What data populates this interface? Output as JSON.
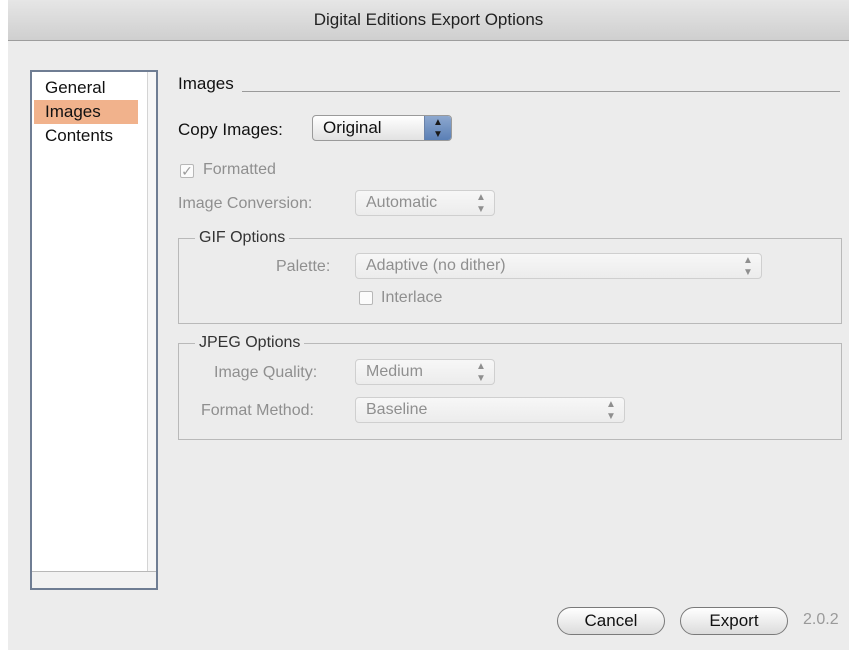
{
  "window": {
    "title": "Digital Editions Export Options"
  },
  "sidebar": {
    "items": [
      {
        "label": "General"
      },
      {
        "label": "Images"
      },
      {
        "label": "Contents"
      }
    ],
    "selected": "Images"
  },
  "images_panel": {
    "section_title": "Images",
    "copy_images": {
      "label": "Copy Images:",
      "value": "Original"
    },
    "formatted": {
      "label": "Formatted",
      "checked": true,
      "enabled": false
    },
    "image_conversion": {
      "label": "Image Conversion:",
      "value": "Automatic",
      "enabled": false
    },
    "gif_options": {
      "title": "GIF Options",
      "palette": {
        "label": "Palette:",
        "value": "Adaptive (no dither)",
        "enabled": false
      },
      "interlace": {
        "label": "Interlace",
        "checked": false,
        "enabled": false
      }
    },
    "jpeg_options": {
      "title": "JPEG Options",
      "image_quality": {
        "label": "Image Quality:",
        "value": "Medium",
        "enabled": false
      },
      "format_method": {
        "label": "Format Method:",
        "value": "Baseline",
        "enabled": false
      }
    }
  },
  "footer": {
    "cancel_label": "Cancel",
    "export_label": "Export",
    "version": "2.0.2"
  },
  "icons": {
    "checkmark": "checkmark-icon",
    "popup_arrows": "up-down-arrows-icon"
  }
}
